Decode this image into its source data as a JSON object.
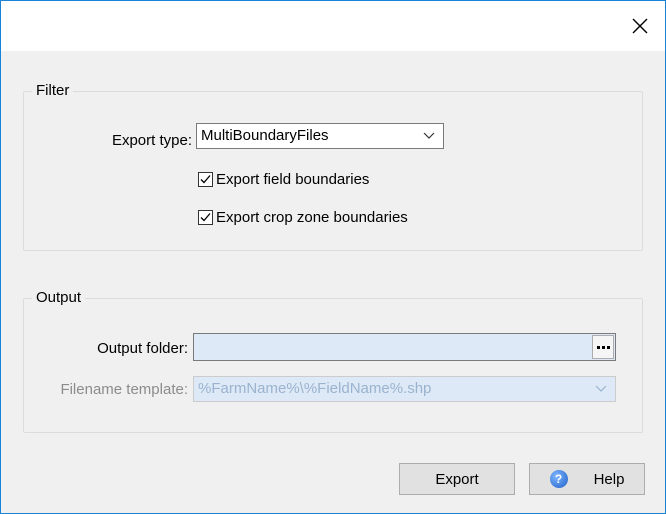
{
  "titlebar": {
    "close_icon": "close-icon"
  },
  "filter": {
    "group_label": "Filter",
    "export_type_label": "Export type:",
    "export_type_value": "MultiBoundaryFiles",
    "export_field_boundaries_label": "Export field boundaries",
    "export_field_boundaries_checked": true,
    "export_crop_zone_boundaries_label": "Export crop zone boundaries",
    "export_crop_zone_boundaries_checked": true
  },
  "output": {
    "group_label": "Output",
    "output_folder_label": "Output folder:",
    "output_folder_value": "",
    "filename_template_label": "Filename template:",
    "filename_template_value": "%FarmName%\\%FieldName%.shp"
  },
  "buttons": {
    "export_label": "Export",
    "help_label": "Help",
    "help_icon_glyph": "?"
  },
  "colors": {
    "window_border": "#1883d7",
    "input_background": "#dde9f7",
    "disabled_text": "#8c8c8c"
  }
}
